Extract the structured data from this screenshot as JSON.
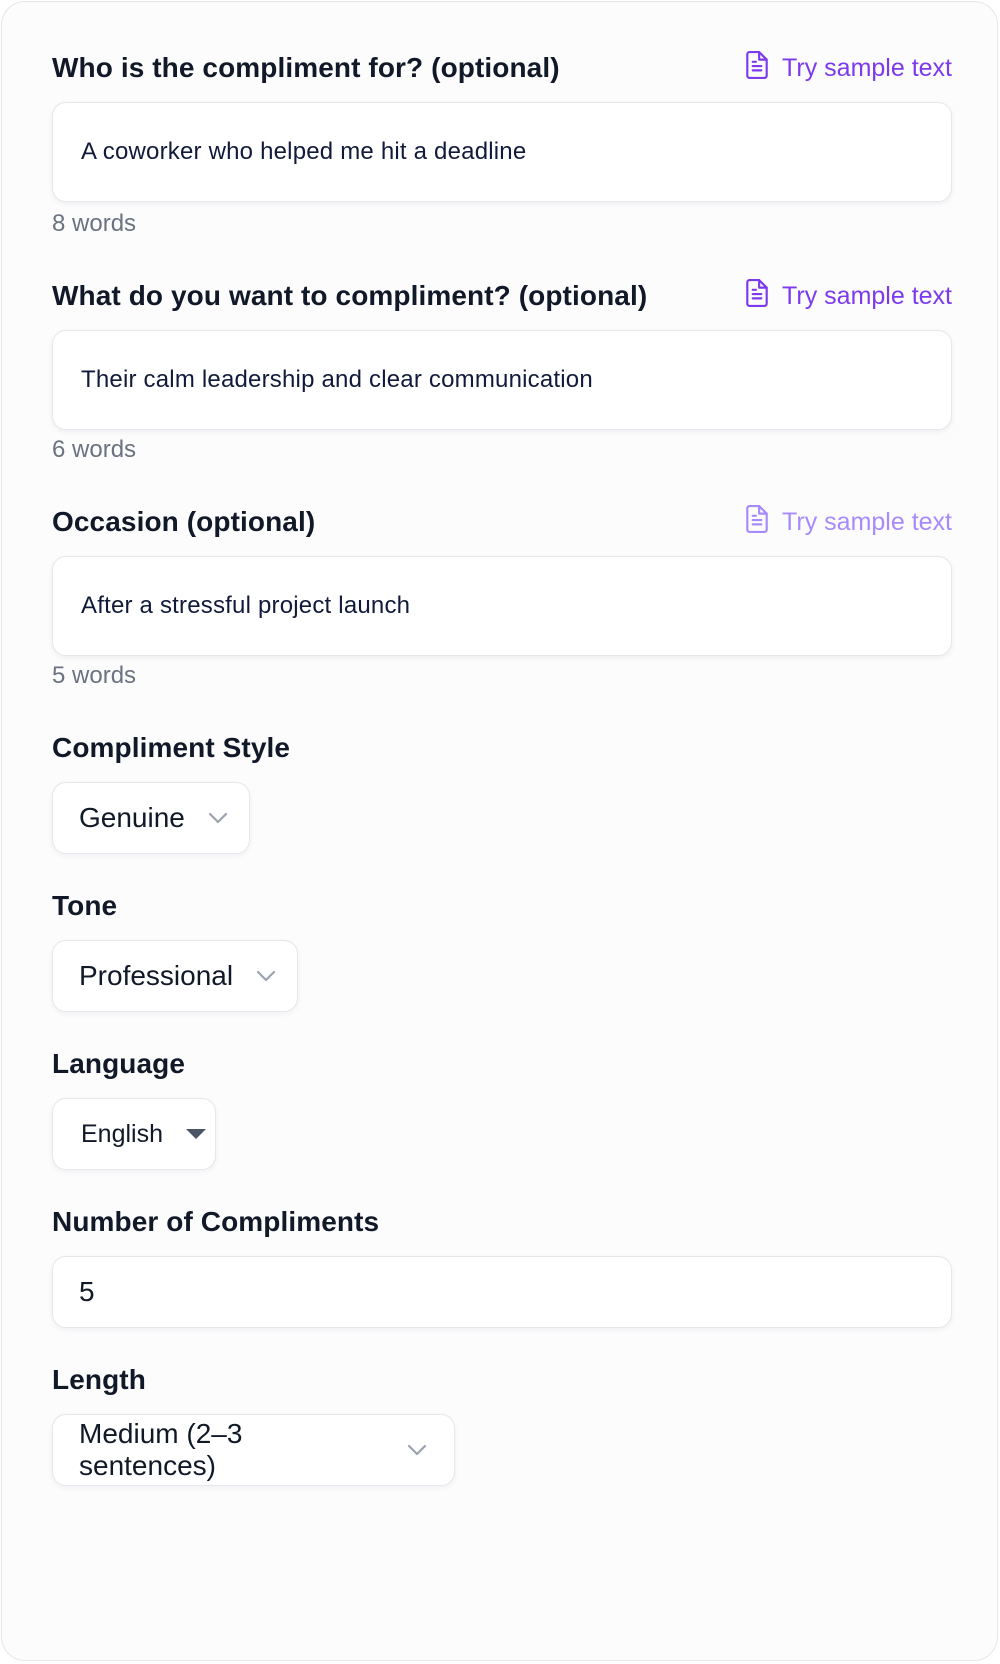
{
  "fields": {
    "recipient": {
      "label": "Who is the compliment for? (optional)",
      "sample_link": "Try sample text",
      "value": "A coworker who helped me hit a deadline",
      "word_count": "8 words"
    },
    "subject": {
      "label": "What do you want to compliment? (optional)",
      "sample_link": "Try sample text",
      "value": "Their calm leadership and clear communication",
      "word_count": "6 words"
    },
    "occasion": {
      "label": "Occasion (optional)",
      "sample_link": "Try sample text",
      "value": "After a stressful project launch",
      "word_count": "5 words"
    }
  },
  "style": {
    "label": "Compliment Style",
    "selected": "Genuine"
  },
  "tone": {
    "label": "Tone",
    "selected": "Professional"
  },
  "language": {
    "label": "Language",
    "selected": "English"
  },
  "count": {
    "label": "Number of Compliments",
    "value": "5"
  },
  "length": {
    "label": "Length",
    "selected": "Medium (2–3 sentences)"
  },
  "icons": {
    "sample": "document-icon",
    "dropdown": "chevron-down-icon",
    "native_dropdown": "caret-down-icon"
  },
  "colors": {
    "accent": "#7c3aed",
    "accent_faded": "#a78bfa",
    "text": "#111827",
    "muted": "#6b7280",
    "border": "#e5e7eb"
  }
}
